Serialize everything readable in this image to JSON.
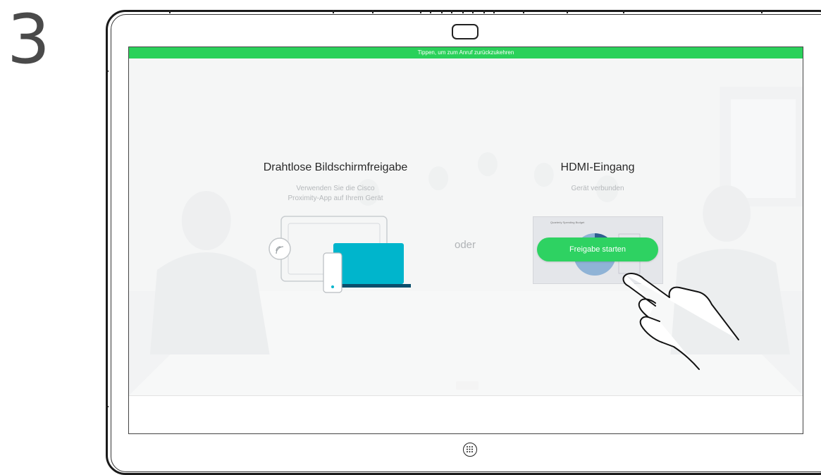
{
  "step": {
    "number": "3"
  },
  "banner": {
    "text": "Tippen, um zum Anruf zurückzukehren",
    "color": "#2ad15a"
  },
  "wireless": {
    "title": "Drahtlose Bildschirmfreigabe",
    "subtitle_line1": "Verwenden Sie die Cisco",
    "subtitle_line2": "Proximity-App auf Ihrem Gerät",
    "icon": "proximity-app-icon"
  },
  "separator": {
    "text": "oder"
  },
  "hdmi": {
    "title": "HDMI-Eingang",
    "subtitle": "Gerät verbunden",
    "thumbnail_label": "Quarterly Spending Budget",
    "button_label": "Freigabe starten",
    "button_color": "#2ed262"
  },
  "accent_colors": {
    "laptop": "#00b5cc",
    "laptop_base": "#0b4f6c"
  },
  "icons": [
    "camera-icon",
    "home-button-icon",
    "proximity-wireless-icon",
    "laptop-icon",
    "phone-icon",
    "hand-pointer-icon"
  ]
}
